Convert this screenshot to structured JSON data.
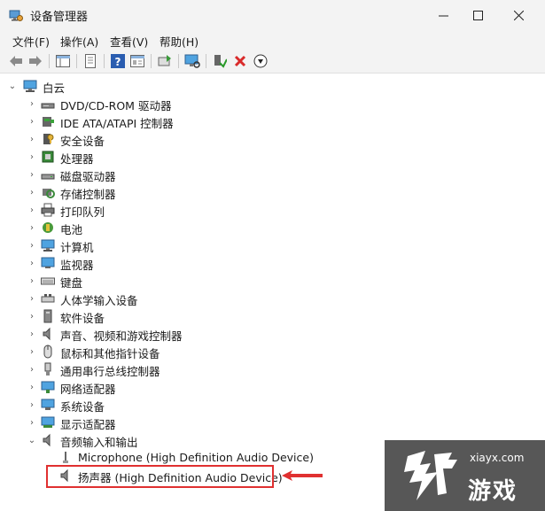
{
  "window": {
    "title": "设备管理器",
    "minimize_icon": "minimize-icon",
    "maximize_icon": "maximize-icon",
    "close_icon": "close-icon"
  },
  "menu": {
    "items": [
      "文件(F)",
      "操作(A)",
      "查看(V)",
      "帮助(H)"
    ]
  },
  "toolbar": {
    "buttons": [
      "back-arrow-icon",
      "forward-arrow-icon",
      "show-hide-tree-icon",
      "properties-icon",
      "help-icon",
      "view-icon",
      "update-driver-icon",
      "monitor-scan-icon",
      "enable-device-icon",
      "uninstall-icon",
      "download-icon"
    ]
  },
  "tree": {
    "root": "白云",
    "categories": [
      "DVD/CD-ROM 驱动器",
      "IDE ATA/ATAPI 控制器",
      "安全设备",
      "处理器",
      "磁盘驱动器",
      "存储控制器",
      "打印队列",
      "电池",
      "计算机",
      "监视器",
      "键盘",
      "人体学输入设备",
      "软件设备",
      "声音、视频和游戏控制器",
      "鼠标和其他指针设备",
      "通用串行总线控制器",
      "网络适配器",
      "系统设备",
      "显示适配器",
      "音频输入和输出"
    ],
    "audio_children": [
      "Microphone (High Definition Audio Device)",
      "扬声器 (High Definition Audio Device)"
    ]
  },
  "watermark": {
    "url": "xiayx.com",
    "text": "游戏"
  },
  "colors": {
    "highlight": "#e03030",
    "accent": "#1f6fd1"
  }
}
